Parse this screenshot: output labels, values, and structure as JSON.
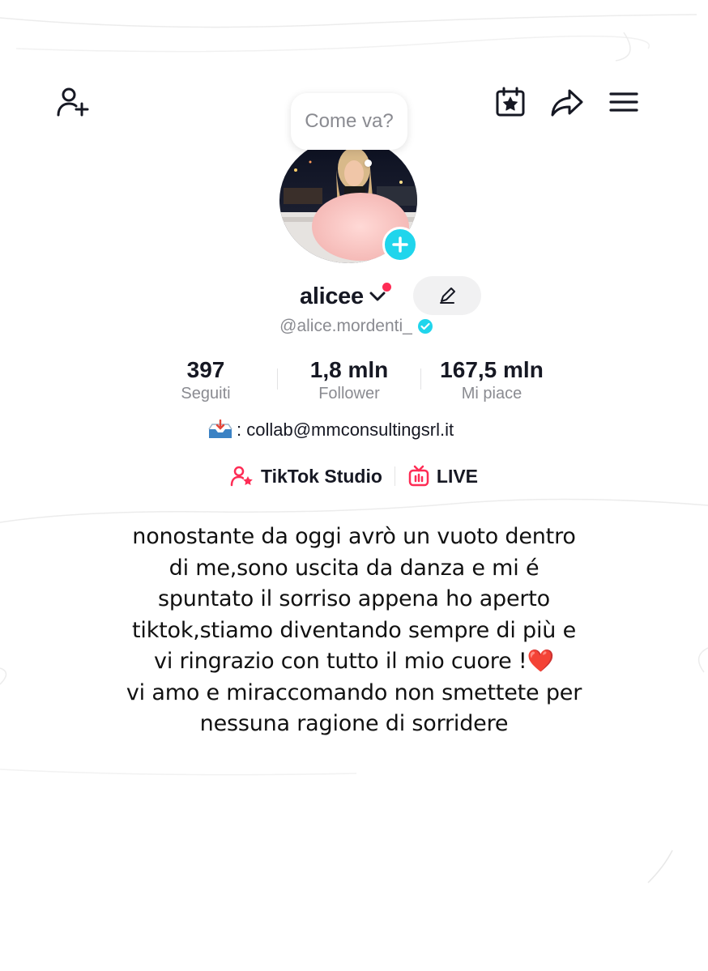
{
  "header": {
    "icons": [
      "add-friend-icon",
      "calendar-star-icon",
      "share-icon",
      "menu-icon"
    ]
  },
  "bubble": {
    "text": "Come va?"
  },
  "profile": {
    "display_name": "alicee",
    "handle": "@alice.mordenti_",
    "verified": true,
    "accent_color": "#20d5ec",
    "notification_color": "#fe2c55"
  },
  "stats": [
    {
      "value": "397",
      "label": "Seguiti"
    },
    {
      "value": "1,8 mln",
      "label": "Follower"
    },
    {
      "value": "167,5 mln",
      "label": "Mi piace"
    }
  ],
  "contact": {
    "icon": "inbox-tray-icon",
    "text": ": collab@mmconsultingsrl.it"
  },
  "links": [
    {
      "label": "TikTok Studio",
      "icon": "creator-star-icon"
    },
    {
      "label": "LIVE",
      "icon": "live-tv-icon"
    }
  ],
  "note": {
    "lines": [
      "nonostante da oggi avrò un vuoto dentro",
      "di me,sono uscita da danza e mi é",
      "spuntato il sorriso appena ho aperto",
      "tiktok,stiamo diventando sempre di più e",
      "vi ringrazio con tutto il mio cuore !",
      "vi amo e miraccomando non smettete per",
      "nessuna ragione di sorridere"
    ],
    "emoji": "❤️"
  }
}
